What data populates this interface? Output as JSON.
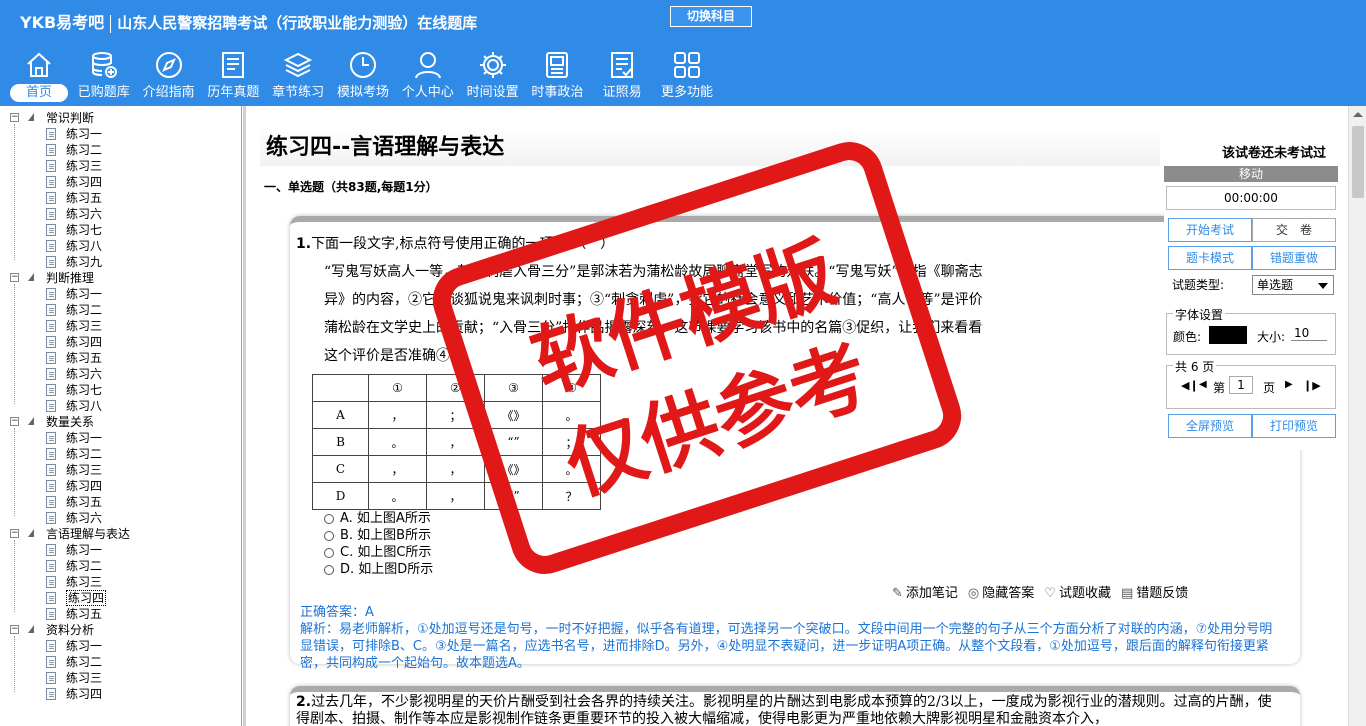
{
  "header": {
    "logo": "YKB易考吧",
    "title": "山东人民警察招聘考试（行政职业能力测验）在线题库",
    "switch_label": "切换科目"
  },
  "nav": [
    {
      "label": "首页",
      "icon": "home-icon"
    },
    {
      "label": "已购题库",
      "icon": "database-icon"
    },
    {
      "label": "介绍指南",
      "icon": "compass-icon"
    },
    {
      "label": "历年真题",
      "icon": "document-icon"
    },
    {
      "label": "章节练习",
      "icon": "layers-icon"
    },
    {
      "label": "模拟考场",
      "icon": "clock-icon"
    },
    {
      "label": "个人中心",
      "icon": "user-icon"
    },
    {
      "label": "时间设置",
      "icon": "gear-icon"
    },
    {
      "label": "时事政治",
      "icon": "book-icon"
    },
    {
      "label": "证照易",
      "icon": "checklist-icon"
    },
    {
      "label": "更多功能",
      "icon": "grid-icon"
    }
  ],
  "tree": [
    {
      "label": "常识判断",
      "items": [
        "练习一",
        "练习二",
        "练习三",
        "练习四",
        "练习五",
        "练习六",
        "练习七",
        "练习八",
        "练习九"
      ]
    },
    {
      "label": "判断推理",
      "items": [
        "练习一",
        "练习二",
        "练习三",
        "练习四",
        "练习五",
        "练习六",
        "练习七",
        "练习八"
      ]
    },
    {
      "label": "数量关系",
      "items": [
        "练习一",
        "练习二",
        "练习三",
        "练习四",
        "练习五",
        "练习六"
      ]
    },
    {
      "label": "言语理解与表达",
      "items": [
        "练习一",
        "练习二",
        "练习三",
        "练习四",
        "练习五"
      ],
      "selected": 3
    },
    {
      "label": "资料分析",
      "items": [
        "练习一",
        "练习二",
        "练习三",
        "练习四"
      ]
    }
  ],
  "paper": {
    "title": "练习四--言语理解与表达",
    "status": "该试卷还未考试过",
    "section": "一、单选题（共83题,每题1分）"
  },
  "q1": {
    "num": "1.",
    "stem": "下面一段文字,标点符号使用正确的一项是:（　）",
    "passage": "“写鬼写妖高人一等，刺贪刺虐入骨三分”是郭沫若为蒲松龄故居聊斋堂写的对联。“写鬼写妖”，指《聊斋志异》的内容，②它借谈狐说鬼来讽刺时事；③“刺贪刺虐”，指它的社会意义和艺术价值；“高人一等”是评价蒲松龄在文学史上的贡献；“入骨三分”指作品揭露深刻。这节课要学习该书中的名篇③促织，让我们来看看这个评价是否准确④",
    "table_header": [
      "",
      "①",
      "②",
      "③",
      "④"
    ],
    "table_rows": [
      [
        "A",
        "，",
        "；",
        "《》",
        "。"
      ],
      [
        "B",
        "。",
        "，",
        "“”",
        "；"
      ],
      [
        "C",
        "，",
        "，",
        "《》",
        "。"
      ],
      [
        "D",
        "。",
        "，",
        "“”",
        "？"
      ]
    ],
    "options": [
      "A. 如上图A所示",
      "B. 如上图B所示",
      "C. 如上图C所示",
      "D. 如上图D所示"
    ],
    "actions": [
      "添加笔记",
      "隐藏答案",
      "试题收藏",
      "错题反馈"
    ],
    "answer_label": "正确答案：A",
    "analysis": "解析：易老师解析，①处加逗号还是句号，一时不好把握，似乎各有道理，可选择另一个突破口。文段中间用一个完整的句子从三个方面分析了对联的内涵，⑦处用分号明显错误，可排除B、C。③处是一篇名，应选书名号，进而排除D。另外，④处明显不表疑问，进一步证明A项正确。从整个文段看，①处加逗号，跟后面的解释句衔接更紧密，共同构成一个起始句。故本题选A。"
  },
  "q2": {
    "num": "2.",
    "text": "过去几年，不少影视明星的天价片酬受到社会各界的持续关注。影视明星的片酬达到电影成本预算的2/3以上，一度成为影视行业的潜规则。过高的片酬，使得剧本、拍摄、制作等本应是影视制作链条更重要环节的投入被大幅缩减，使得电影更为严重地依赖大牌影视明星和金融资本介入，"
  },
  "panel": {
    "header": "移动",
    "timer": "00:00:00",
    "start": "开始考试",
    "submit": "交　卷",
    "card_mode": "题卡模式",
    "wrong_redo": "错题重做",
    "qtype_label": "试题类型:",
    "qtype_value": "单选题",
    "font_legend": "字体设置",
    "color_label": "颜色:",
    "size_label": "大小:",
    "size_value": "10",
    "pages_legend": "共 6 页",
    "page_prefix": "第",
    "page_value": "1",
    "page_suffix": "页",
    "fullscreen": "全屏预览",
    "print": "打印预览"
  },
  "watermark": {
    "line1": "软件模版",
    "line2": "仅供参考",
    "color": "#e01818"
  },
  "colors": {
    "accent": "#2f8be6"
  }
}
